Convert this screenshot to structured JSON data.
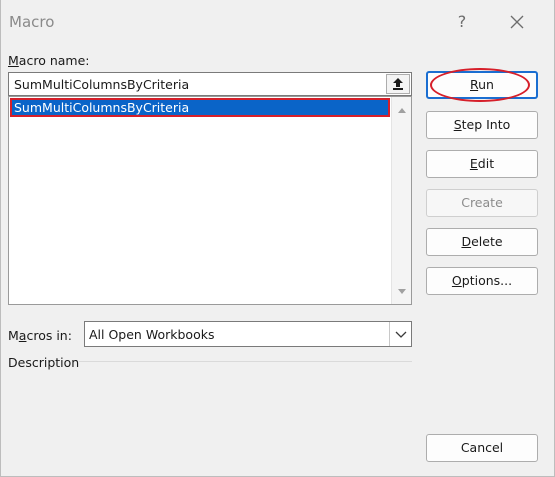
{
  "window": {
    "title": "Macro",
    "help_label": "?"
  },
  "macro_name": {
    "label_accel": "M",
    "label_rest": "acro name:",
    "value": "SumMultiColumnsByCriteria"
  },
  "macro_list": {
    "items": [
      "SumMultiColumnsByCriteria"
    ],
    "selected_index": 0
  },
  "buttons": {
    "run": {
      "accel": "R",
      "rest": "un"
    },
    "step_into": {
      "accel": "S",
      "rest": "tep Into"
    },
    "edit": {
      "accel": "E",
      "rest": "dit"
    },
    "create": {
      "label": "Create"
    },
    "delete": {
      "accel": "D",
      "rest": "elete"
    },
    "options": {
      "accel": "O",
      "rest": "ptions..."
    },
    "cancel": {
      "label": "Cancel"
    }
  },
  "macros_in": {
    "label_pre": "M",
    "label_accel": "a",
    "label_rest": "cros in:",
    "value": "All Open Workbooks"
  },
  "description": {
    "label": "Description"
  },
  "colors": {
    "accent": "#1a6ed1",
    "selection": "#0a64c8",
    "highlight_annotation": "#d61f2a"
  }
}
